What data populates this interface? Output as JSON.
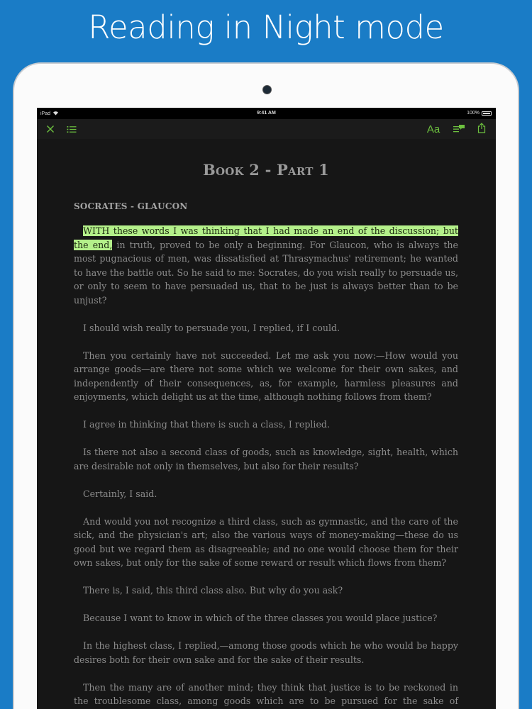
{
  "banner": {
    "text": "Reading in Night mode"
  },
  "status_bar": {
    "device": "iPad",
    "time": "9:41 AM",
    "battery": "100%"
  },
  "toolbar": {
    "left_icons": [
      "close-icon",
      "contents-list-icon"
    ],
    "right_icons": [
      "font-settings-icon",
      "notes-icon",
      "share-icon"
    ],
    "font_label": "Aa"
  },
  "colors": {
    "accent": "#6dc13f",
    "highlight": "#b4f08a",
    "background": "#161616",
    "banner_bg": "#1a7cc6"
  },
  "book": {
    "title": "Book 2 - Part 1",
    "section": "SOCRATES - GLAUCON",
    "highlighted_text": "WITH these words I was thinking that I had made an end of the discussion; but the end,",
    "first_para_rest": " in truth, proved to be only a beginning. For Glaucon, who is always the most pugnacious of men, was dissatisfied at Thrasymachus' retirement; he wanted to have the battle out. So he said to me: Socrates, do you wish really to persuade us, or only to seem to have persuaded us, that to be just is always better than to be unjust?",
    "paragraphs": [
      "I should wish really to persuade you, I replied, if I could.",
      "Then you certainly have not succeeded. Let me ask you now:—How would you arrange goods—are there not some which we welcome for their own sakes, and independently of their consequences, as, for example, harmless pleasures and enjoyments, which delight us at the time, although nothing follows from them?",
      "I agree in thinking that there is such a class, I replied.",
      "Is there not also a second class of goods, such as knowledge, sight, health, which are desirable not only in themselves, but also for their results?",
      "Certainly, I said.",
      "And would you not recognize a third class, such as gymnastic, and the care of the sick, and the physician's art; also the various ways of money-making—these do us good but we regard them as disagreeable; and no one would choose them for their own sakes, but only for the sake of some reward or result which flows from them?",
      "There is, I said, this third class also. But why do you ask?",
      "Because I want to know in which of the three classes you would place justice?",
      "In the highest class, I replied,—among those goods which he who would be happy desires both for their own sake and for the sake of their results.",
      "Then the many are of another mind; they think that justice is to be reckoned in the troublesome class, among goods which are to be pursued for the sake of rewards and of"
    ]
  }
}
